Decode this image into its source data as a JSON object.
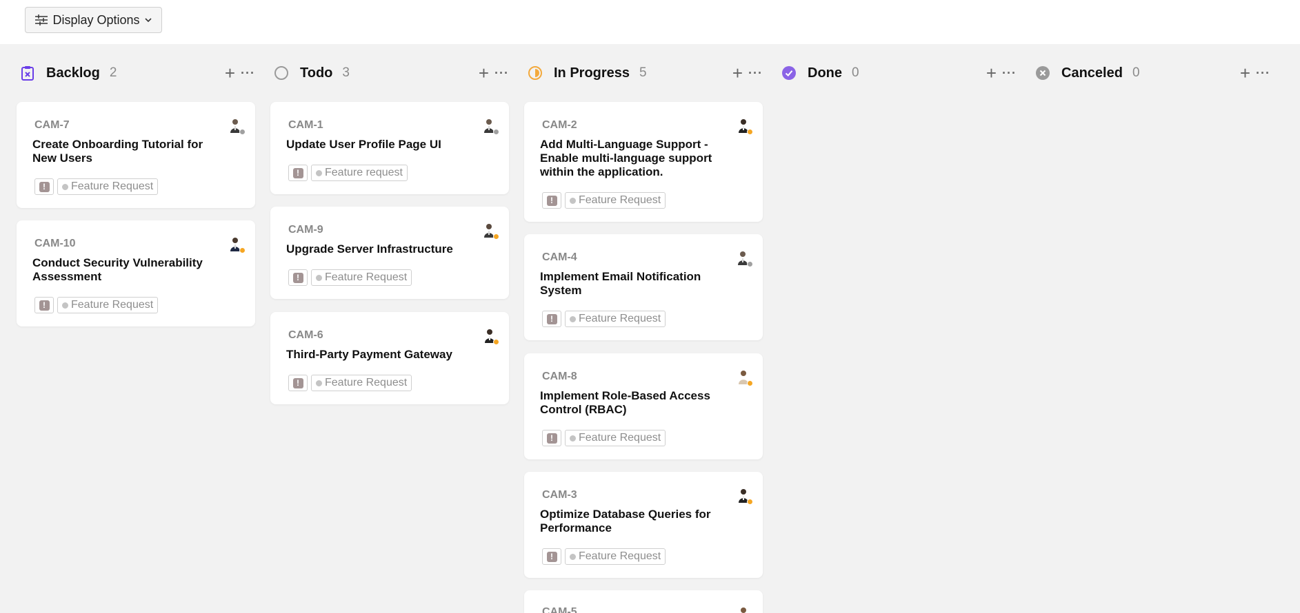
{
  "toolbar": {
    "display_options_label": "Display Options"
  },
  "colors": {
    "background": "#f2f2f2",
    "backlog": "#6a3ee8",
    "todo": "#9a9a9a",
    "in_progress": "#f3a93c",
    "done": "#8a63e6",
    "canceled": "#9a9a9a",
    "status_online": "#f5a623",
    "status_offline": "#a0a0a0"
  },
  "columns": [
    {
      "title": "Backlog",
      "count": "2",
      "icon": "backlog-icon",
      "cards": [
        {
          "id": "CAM-7",
          "title": "Create Onboarding Tutorial for New Users",
          "label": "Feature Request",
          "priority_icon": "urgent-priority-icon",
          "avatar_status": "offline"
        },
        {
          "id": "CAM-10",
          "title": "Conduct Security Vulnerability Assessment",
          "label": "Feature Request",
          "priority_icon": "urgent-priority-icon",
          "avatar_status": "online"
        }
      ]
    },
    {
      "title": "Todo",
      "count": "3",
      "icon": "todo-icon",
      "cards": [
        {
          "id": "CAM-1",
          "title": "Update User Profile Page UI",
          "label": "Feature request",
          "priority_icon": "urgent-priority-icon",
          "avatar_status": "offline"
        },
        {
          "id": "CAM-9",
          "title": "Upgrade Server Infrastructure",
          "label": "Feature Request",
          "priority_icon": "urgent-priority-icon",
          "avatar_status": "online"
        },
        {
          "id": "CAM-6",
          "title": "Third-Party Payment Gateway",
          "label": "Feature Request",
          "priority_icon": "urgent-priority-icon",
          "avatar_status": "online"
        }
      ]
    },
    {
      "title": "In Progress",
      "count": "5",
      "icon": "in-progress-icon",
      "cards": [
        {
          "id": "CAM-2",
          "title": "Add Multi-Language Support - Enable multi-language support within the application.",
          "label": "Feature Request",
          "priority_icon": "urgent-priority-icon",
          "avatar_status": "online"
        },
        {
          "id": "CAM-4",
          "title": "Implement Email Notification System",
          "label": "Feature Request",
          "priority_icon": "urgent-priority-icon",
          "avatar_status": "offline"
        },
        {
          "id": "CAM-8",
          "title": "Implement Role-Based Access Control (RBAC)",
          "label": "Feature Request",
          "priority_icon": "urgent-priority-icon",
          "avatar_status": "online"
        },
        {
          "id": "CAM-3",
          "title": "Optimize Database Queries for Performance",
          "label": "Feature Request",
          "priority_icon": "urgent-priority-icon",
          "avatar_status": "online"
        },
        {
          "id": "CAM-5",
          "title": "",
          "label": "",
          "priority_icon": "urgent-priority-icon",
          "avatar_status": "online"
        }
      ]
    },
    {
      "title": "Done",
      "count": "0",
      "icon": "done-icon",
      "cards": []
    },
    {
      "title": "Canceled",
      "count": "0",
      "icon": "canceled-icon",
      "cards": []
    }
  ]
}
